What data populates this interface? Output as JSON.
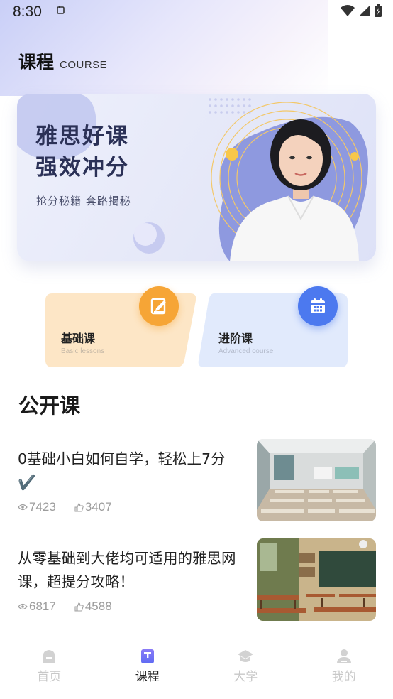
{
  "status_bar": {
    "time": "8:30"
  },
  "header": {
    "title": "课程",
    "subtitle": "COURSE"
  },
  "banner": {
    "title_line1": "雅思好课",
    "title_line2": "强效冲分",
    "subtitle": "抢分秘籍  套路揭秘"
  },
  "categories": [
    {
      "label": "基础课",
      "sublabel": "Basic lessons",
      "icon": "edit-icon",
      "color": "#f6a536"
    },
    {
      "label": "进阶课",
      "sublabel": "Advanced course",
      "icon": "calendar-icon",
      "color": "#4c79ef"
    }
  ],
  "section": {
    "title": "公开课"
  },
  "courses": [
    {
      "title": "0基础小白如何自学，轻松上7分✔️",
      "views": "7423",
      "likes": "3407"
    },
    {
      "title": "从零基础到大佬均可适用的雅思网课，超提分攻略！",
      "views": "6817",
      "likes": "4588"
    }
  ],
  "nav": [
    {
      "label": "首页",
      "icon": "home-icon",
      "active": false
    },
    {
      "label": "课程",
      "icon": "course-icon",
      "active": true
    },
    {
      "label": "大学",
      "icon": "graduation-cap-icon",
      "active": false
    },
    {
      "label": "我的",
      "icon": "user-icon",
      "active": false
    }
  ],
  "colors": {
    "accent": "#6b6ef5",
    "inactive": "#c8c8c8",
    "orange": "#f6a536",
    "blue": "#4c79ef"
  }
}
